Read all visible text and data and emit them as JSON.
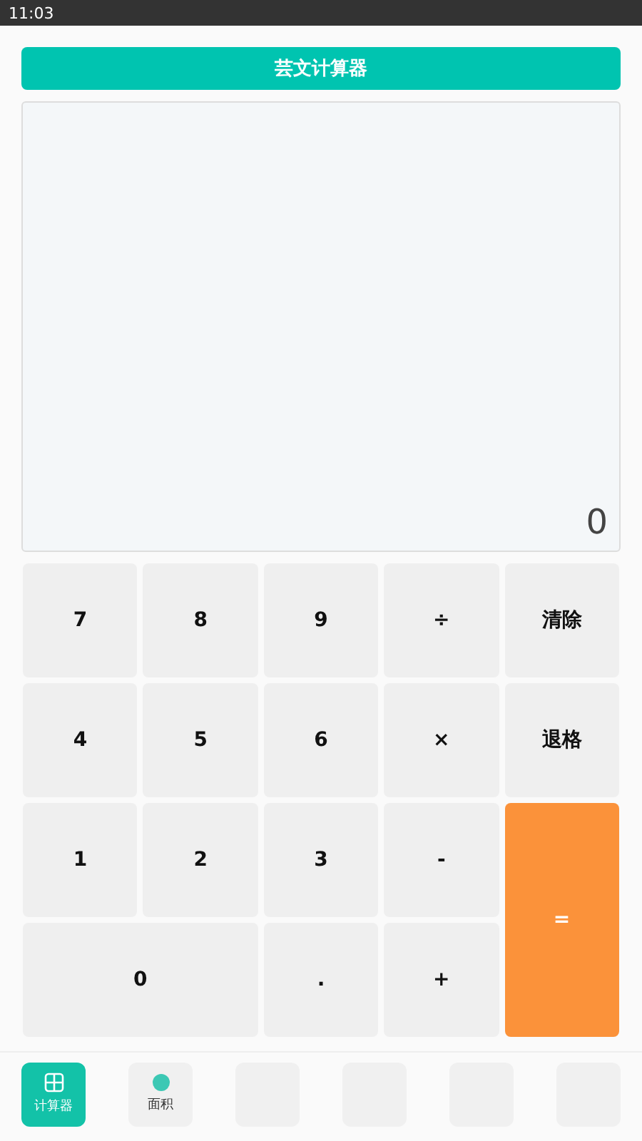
{
  "status_bar": {
    "time": "11:03"
  },
  "title": "芸文计算器",
  "display": {
    "value": "0"
  },
  "keys": [
    {
      "label": "7",
      "kind": "plain"
    },
    {
      "label": "8",
      "kind": "plain"
    },
    {
      "label": "9",
      "kind": "plain"
    },
    {
      "label": "÷",
      "kind": "plain"
    },
    {
      "label": "清除",
      "kind": "plain"
    },
    {
      "label": "4",
      "kind": "plain"
    },
    {
      "label": "5",
      "kind": "plain"
    },
    {
      "label": "6",
      "kind": "plain"
    },
    {
      "label": "×",
      "kind": "plain"
    },
    {
      "label": "退格",
      "kind": "plain"
    },
    {
      "label": "1",
      "kind": "plain"
    },
    {
      "label": "2",
      "kind": "plain"
    },
    {
      "label": "3",
      "kind": "plain"
    },
    {
      "label": "-",
      "kind": "plain"
    },
    {
      "label": "=",
      "kind": "equals"
    },
    {
      "label": "0",
      "kind": "wide"
    },
    {
      "label": ".",
      "kind": "plain"
    },
    {
      "label": "+",
      "kind": "plain"
    }
  ],
  "bottom_nav": [
    {
      "label": "计算器",
      "selected": true,
      "kind": "grid"
    },
    {
      "label": "面积",
      "selected": false,
      "kind": "circle"
    },
    {
      "selected": false
    },
    {
      "selected": false
    },
    {
      "selected": false
    },
    {
      "selected": false
    }
  ]
}
